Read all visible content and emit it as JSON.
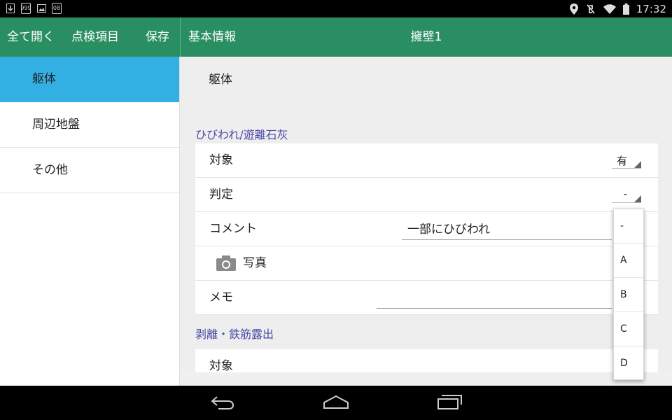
{
  "status_bar": {
    "icons_left": [
      "download-icon",
      "notification-999-icon",
      "image-icon",
      "app-icon"
    ],
    "notif_count": "999",
    "app_glyph": "08",
    "icons_right": [
      "location-icon",
      "vibrate-off-icon",
      "wifi-icon",
      "battery-icon"
    ],
    "time": "17:32"
  },
  "app_bar": {
    "expand_all": "全て開く",
    "inspection_items": "点検項目",
    "save": "保存",
    "section": "基本情報",
    "title": "擁壁1"
  },
  "sidebar": {
    "items": [
      {
        "label": "躯体",
        "active": true
      },
      {
        "label": "周辺地盤",
        "active": false
      },
      {
        "label": "その他",
        "active": false
      }
    ]
  },
  "main": {
    "header": "躯体",
    "groups": [
      {
        "title": "ひびわれ/遊離石灰",
        "rows": {
          "target_label": "対象",
          "target_value": "有",
          "judgement_label": "判定",
          "judgement_value": "-",
          "comment_label": "コメント",
          "comment_value": "一部にひびわれ",
          "photo_label": "写真",
          "memo_label": "メモ",
          "memo_value": ""
        }
      },
      {
        "title": "剥離・鉄筋露出",
        "rows": {
          "target_label": "対象"
        }
      }
    ]
  },
  "dropdown": {
    "options": [
      "-",
      "A",
      "B",
      "C",
      "D"
    ]
  },
  "colors": {
    "app_bar": "#2a8e63",
    "active_item": "#33b0e3",
    "section_title": "#4a4aa8"
  }
}
